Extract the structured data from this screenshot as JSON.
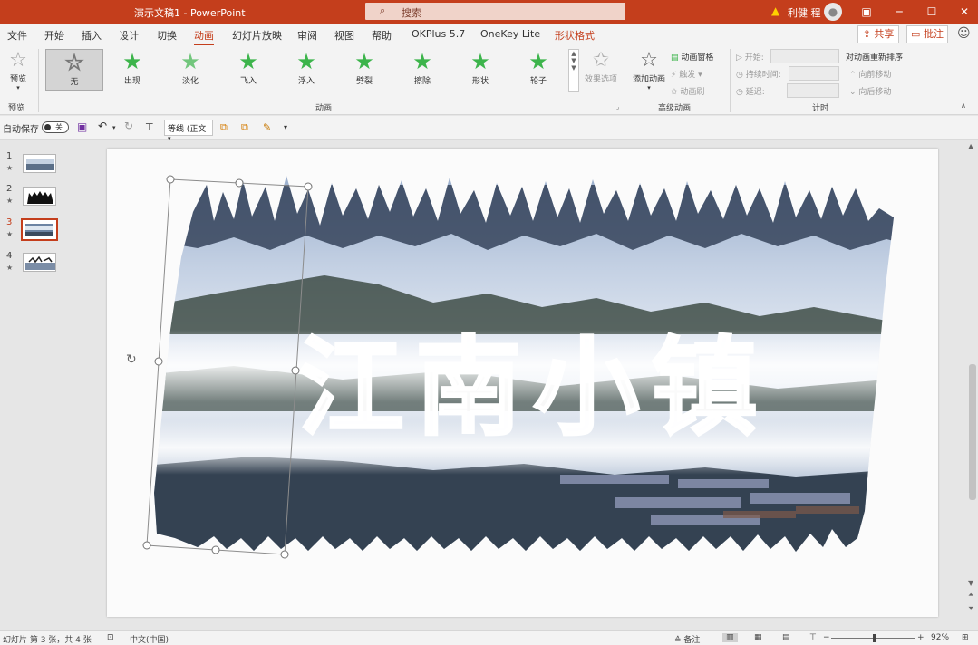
{
  "window": {
    "title": "演示文稿1  -  PowerPoint",
    "search_placeholder": "搜索",
    "user_name": "利健 程",
    "warning_icon": "warning-icon"
  },
  "tabs": [
    {
      "label": "文件"
    },
    {
      "label": "开始"
    },
    {
      "label": "插入"
    },
    {
      "label": "设计"
    },
    {
      "label": "切换"
    },
    {
      "label": "动画",
      "active": true
    },
    {
      "label": "幻灯片放映"
    },
    {
      "label": "审阅"
    },
    {
      "label": "视图"
    },
    {
      "label": "帮助"
    },
    {
      "label": "OKPlus 5.7"
    },
    {
      "label": "OneKey Lite"
    },
    {
      "label": "形状格式",
      "contextual": true
    }
  ],
  "header_actions": {
    "share": "共享",
    "comments": "批注"
  },
  "ribbon": {
    "preview": {
      "label": "预览",
      "group": "预览"
    },
    "animations": [
      {
        "label": "无",
        "selected": true
      },
      {
        "label": "出现"
      },
      {
        "label": "淡化"
      },
      {
        "label": "飞入"
      },
      {
        "label": "浮入"
      },
      {
        "label": "劈裂"
      },
      {
        "label": "擦除"
      },
      {
        "label": "形状"
      },
      {
        "label": "轮子"
      }
    ],
    "effect_options": "效果选项",
    "animation_group": "动画",
    "add_animation": "添加动画",
    "animation_pane": "动画窗格",
    "trigger": "触发",
    "animation_painter": "动画刷",
    "advanced_group": "高级动画",
    "start_label": "开始:",
    "duration_label": "持续时间:",
    "delay_label": "延迟:",
    "reorder_title": "对动画重新排序",
    "move_earlier": "向前移动",
    "move_later": "向后移动",
    "timing_group": "计时"
  },
  "qat": {
    "autosave": "自动保存",
    "autosave_state": "关",
    "font": "等线 (正文"
  },
  "slides": [
    {
      "number": "1"
    },
    {
      "number": "2"
    },
    {
      "number": "3",
      "selected": true
    },
    {
      "number": "4"
    }
  ],
  "slide": {
    "title_text": "江南小镇"
  },
  "status": {
    "slide_info": "幻灯片 第 3 张，共 4 张",
    "language": "中文(中国)",
    "notes": "备注",
    "zoom_minus": "−",
    "zoom_plus": "+",
    "zoom": "92%"
  },
  "colors": {
    "accent": "#c43e1c",
    "star_green": "#3cb44b"
  }
}
